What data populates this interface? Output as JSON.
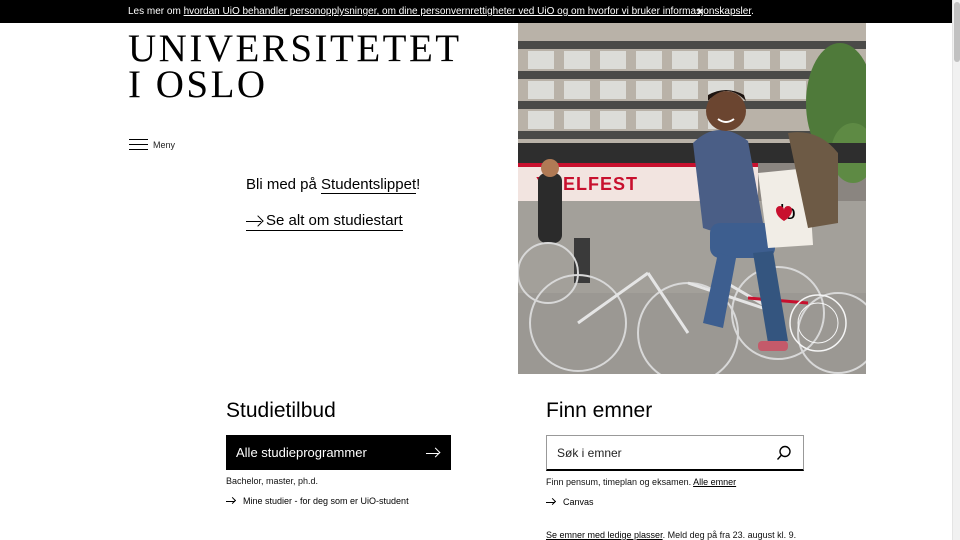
{
  "banner": {
    "prefix": "Les mer om ",
    "link": "hvordan UiO behandler personopplysninger, om dine personvernrettigheter ved UiO og om hvorfor vi bruker informasjonskapsler",
    "suffix": ".",
    "close": "×"
  },
  "logo": {
    "line1": "UNIVERSITETET",
    "line2": "I OSLO"
  },
  "menu": {
    "label": "Meny",
    "icon": "hamburger-icon"
  },
  "promo": {
    "text": "Bli med på ",
    "link": "Studentslippet",
    "suffix": "!",
    "cta": "Se alt om studiestart"
  },
  "hero": {
    "banner_text": "YKELFEST",
    "bag_text": "lo"
  },
  "studietilbud": {
    "heading": "Studietilbud",
    "button": "Alle studieprogrammer",
    "sub": "Bachelor, master, ph.d.",
    "link": "Mine studier - for deg som er UiO-student"
  },
  "finn_emner": {
    "heading": "Finn emner",
    "search_placeholder": "Søk i emner",
    "sub_text": "Finn pensum, timeplan og eksamen. ",
    "sub_link": "Alle emner",
    "canvas": "Canvas",
    "bottom_link": "Se emner med ledige plasser",
    "bottom_text": ". Meld deg på fra 23. august kl. 9."
  },
  "colors": {
    "accent": "#000000",
    "banner_bg": "#000000",
    "promo_banner": "#c8102e"
  }
}
